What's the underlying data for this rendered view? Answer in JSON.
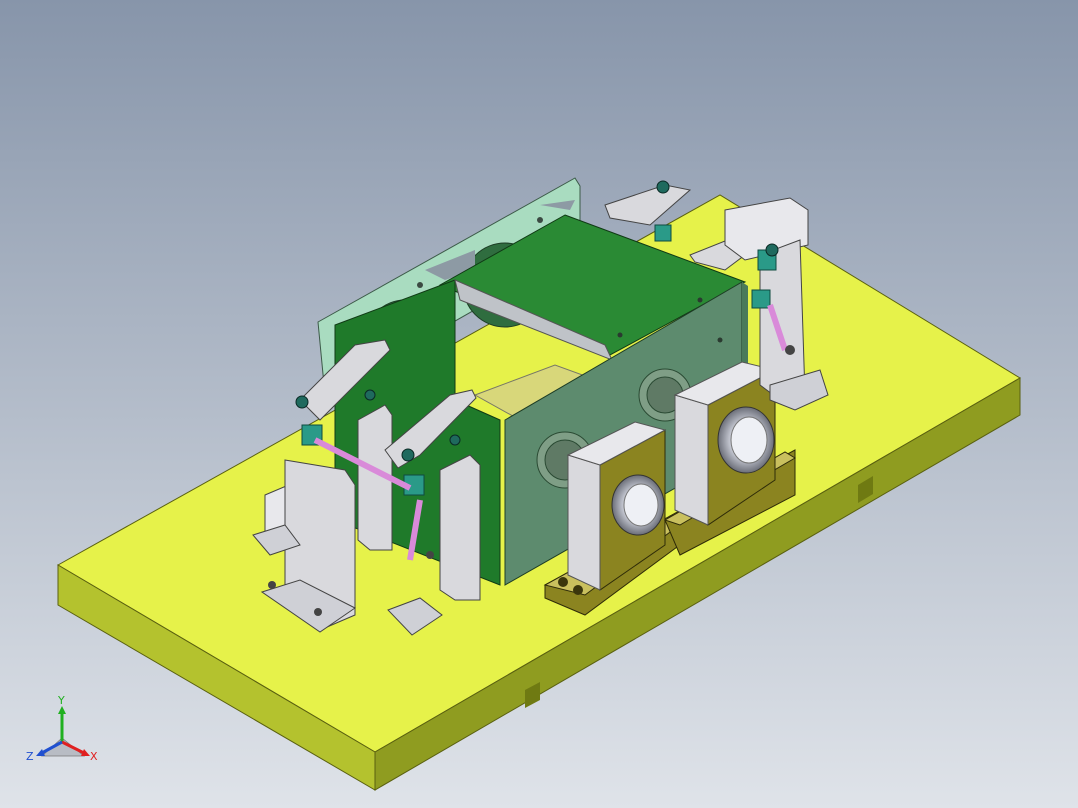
{
  "viewport": {
    "background_top": "#8795aa",
    "background_bottom": "#dfe3e9"
  },
  "colors": {
    "base_plate": "#e6f24a",
    "base_plate_front": "#b4c22e",
    "base_plate_side": "#8f9c20",
    "housing_green": "#1f7a2a",
    "housing_panel": "#5d8b6e",
    "light_panel": "#a9dcc0",
    "fixture_gray": "#d9d9dd",
    "bearing_block": "#8b8420",
    "bearing_block_top": "#c9c05e",
    "clamp_teal": "#2a9a88",
    "link_rod": "#d98ad9"
  },
  "triad": {
    "x_label": "X",
    "y_label": "Y",
    "z_label": "Z",
    "x_color": "#e02020",
    "y_color": "#20b020",
    "z_color": "#2050d0"
  }
}
